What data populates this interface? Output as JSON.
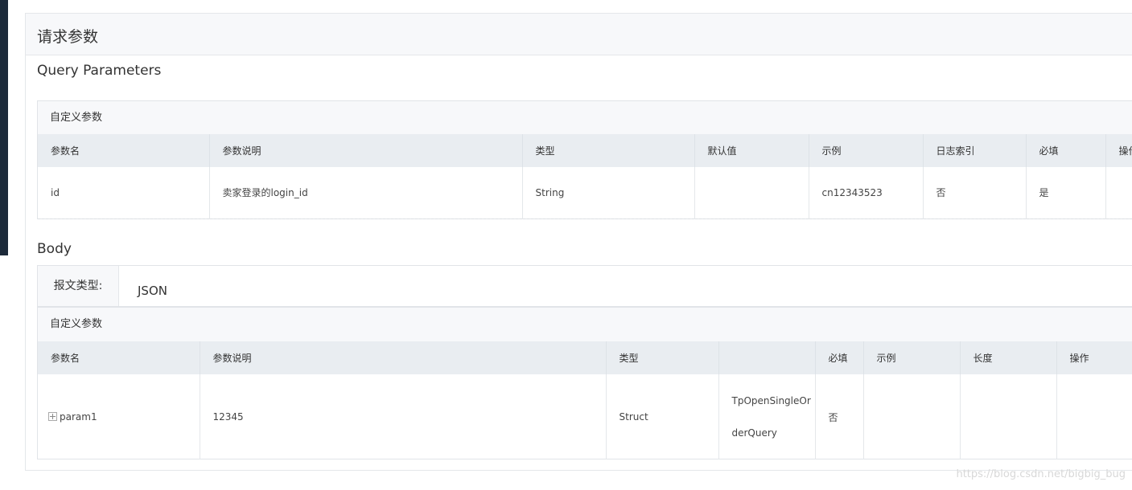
{
  "card": {
    "title": "请求参数"
  },
  "query": {
    "section_title": "Query Parameters",
    "panel_title": "自定义参数",
    "columns": [
      "参数名",
      "参数说明",
      "类型",
      "默认值",
      "示例",
      "日志索引",
      "必填",
      "操作"
    ],
    "rows": [
      [
        "id",
        "卖家登录的login_id",
        "String",
        "",
        "cn12343523",
        "否",
        "是",
        ""
      ]
    ]
  },
  "body": {
    "section_title": "Body",
    "format_label": "报文类型:",
    "format_value": "JSON",
    "panel_title": "自定义参数",
    "columns": [
      "参数名",
      "参数说明",
      "类型",
      "",
      "必填",
      "示例",
      "长度",
      "操作"
    ],
    "rows": [
      {
        "name": "param1",
        "desc": "12345",
        "type": "Struct",
        "struct_line1": "TpOpenSingleOr",
        "struct_line2": "derQuery",
        "required": "否",
        "example": "",
        "length": "",
        "action": ""
      }
    ]
  },
  "watermark": "https://blog.csdn.net/bigbig_bug",
  "icons": {
    "expand": "expand-plus-icon"
  },
  "colors": {
    "header_bg": "#f7f8fa",
    "table_head_bg": "#e9edf1",
    "border": "#e4e7ea",
    "dark_edge": "#1c2a3a"
  }
}
